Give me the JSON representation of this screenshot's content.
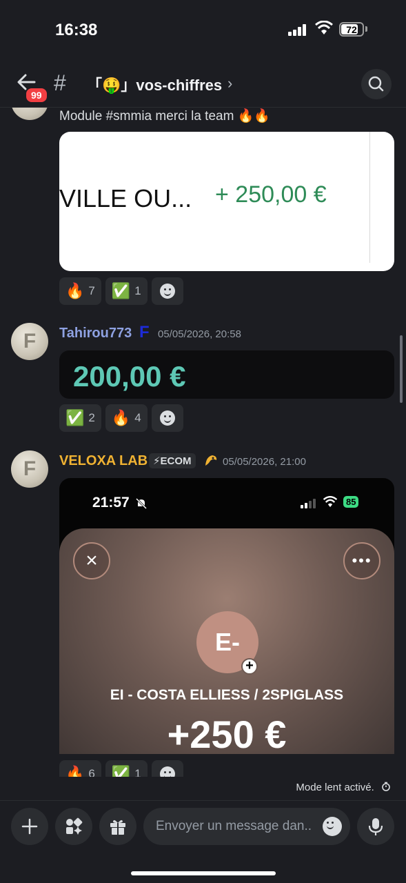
{
  "status_bar": {
    "time": "16:38",
    "battery": "72"
  },
  "header": {
    "badge": "99",
    "hash": "#",
    "channel_name": "「🤑」vos-chiffres",
    "chevron": "›"
  },
  "messages": [
    {
      "caption": "Module #smmia merci la team  🔥🔥",
      "image_text_left": "VILLE OU...",
      "image_amount": "+  250,00 €",
      "reactions": [
        {
          "emoji": "🔥",
          "count": "7"
        },
        {
          "emoji": "✅",
          "count": "1"
        }
      ]
    },
    {
      "username": "Tahirou773",
      "user_badge": "F",
      "timestamp": "05/05/2026, 20:58",
      "amount": "200,00 €",
      "reactions": [
        {
          "emoji": "✅",
          "count": "2"
        },
        {
          "emoji": "🔥",
          "count": "4"
        }
      ]
    },
    {
      "username": "VELOXA LAB",
      "tag": "⚡ECOM",
      "timestamp": "05/05/2026, 21:00",
      "screenshot": {
        "time": "21:57",
        "battery": "85",
        "initials": "E-",
        "merchant": "EI - COSTA ELLIESS / 2SPIGLASS",
        "amount": "+250 €"
      },
      "reactions": [
        {
          "emoji": "🔥",
          "count": "6"
        },
        {
          "emoji": "✅",
          "count": "1"
        }
      ]
    }
  ],
  "slow_mode": "Mode lent activé.",
  "composer": {
    "placeholder": "Envoyer un message dan.."
  },
  "colors": {
    "accent_teal": "#5ec8b5",
    "gain_green": "#2e8b57",
    "badge_red": "#f23f43",
    "username_gold": "#f0b232",
    "username_blue": "#8ea1e1"
  }
}
